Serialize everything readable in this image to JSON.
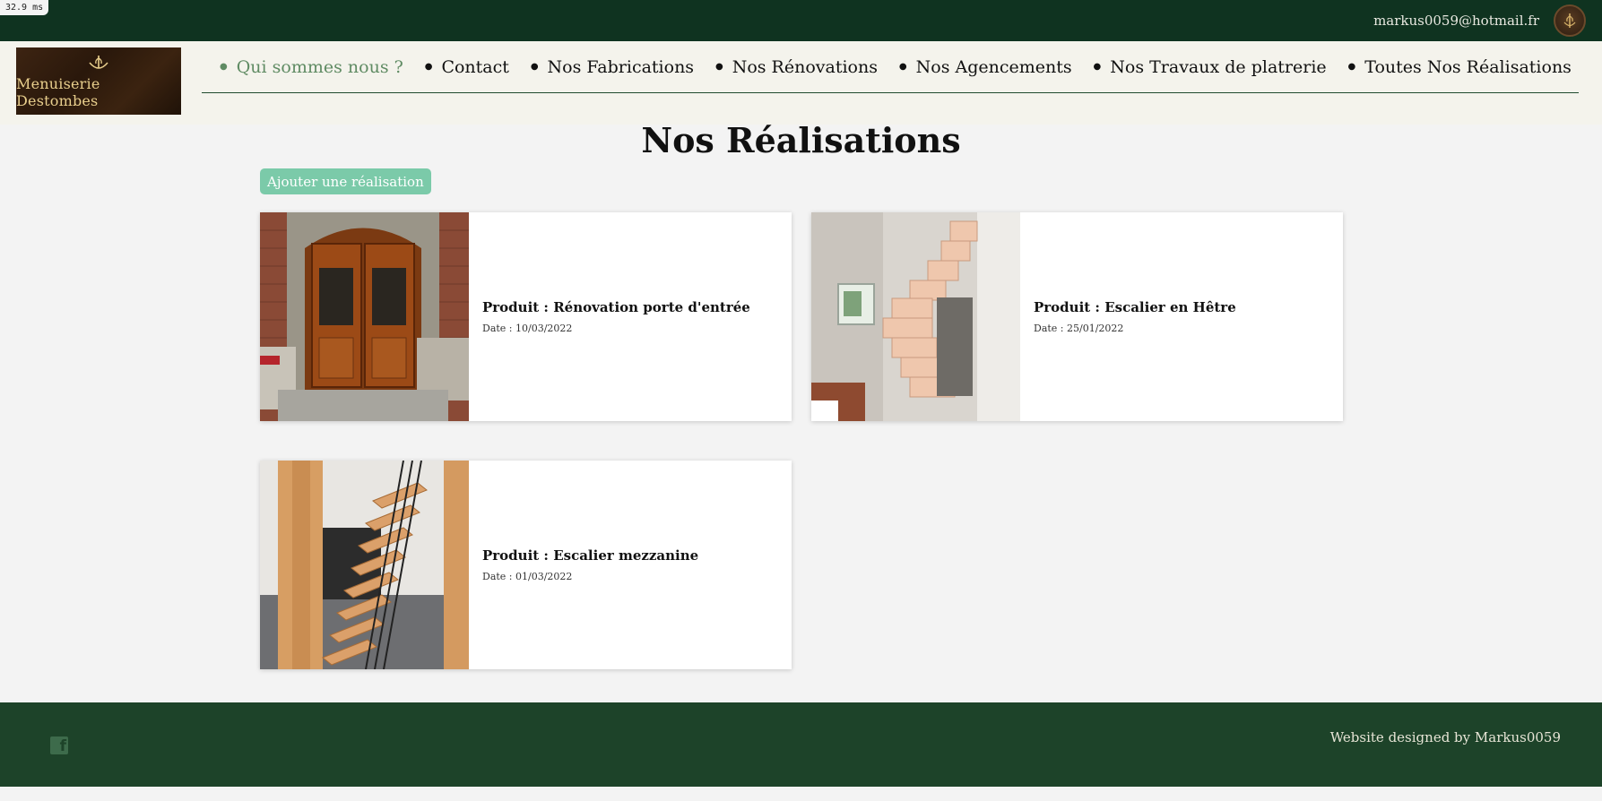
{
  "perf": {
    "label": "32.9 ms"
  },
  "header": {
    "user_email": "markus0059@hotmail.fr",
    "avatar_icon": "emblem-icon"
  },
  "brand": {
    "name": "Menuiserie Destombes",
    "icon": "wheat-emblem-icon"
  },
  "nav": {
    "items": [
      {
        "label": "Qui sommes nous ?",
        "active": true
      },
      {
        "label": "Contact"
      },
      {
        "label": "Nos Fabrications"
      },
      {
        "label": "Nos Rénovations"
      },
      {
        "label": "Nos Agencements"
      },
      {
        "label": "Nos Travaux de platrerie"
      },
      {
        "label": "Toutes Nos Réalisations"
      }
    ]
  },
  "main": {
    "title": "Nos Réalisations",
    "add_button": "Ajouter une réalisation",
    "cards": [
      {
        "title": "Produit : Rénovation porte d'entrée",
        "date": "Date : 10/03/2022",
        "image": "wooden-double-door-photo"
      },
      {
        "title": "Produit : Escalier en Hêtre",
        "date": "Date : 25/01/2022",
        "image": "beech-staircase-photo"
      },
      {
        "title": "Produit : Escalier mezzanine",
        "date": "Date : 01/03/2022",
        "image": "mezzanine-staircase-photo"
      }
    ]
  },
  "footer": {
    "social_icon": "facebook-icon",
    "credit": "Website designed by Markus0059"
  },
  "colors": {
    "topbar": "#0f3320",
    "footer": "#1d4329",
    "nav_bg": "#f4f3ec",
    "accent_green": "#5f8b63",
    "button": "#7bcaa9"
  }
}
